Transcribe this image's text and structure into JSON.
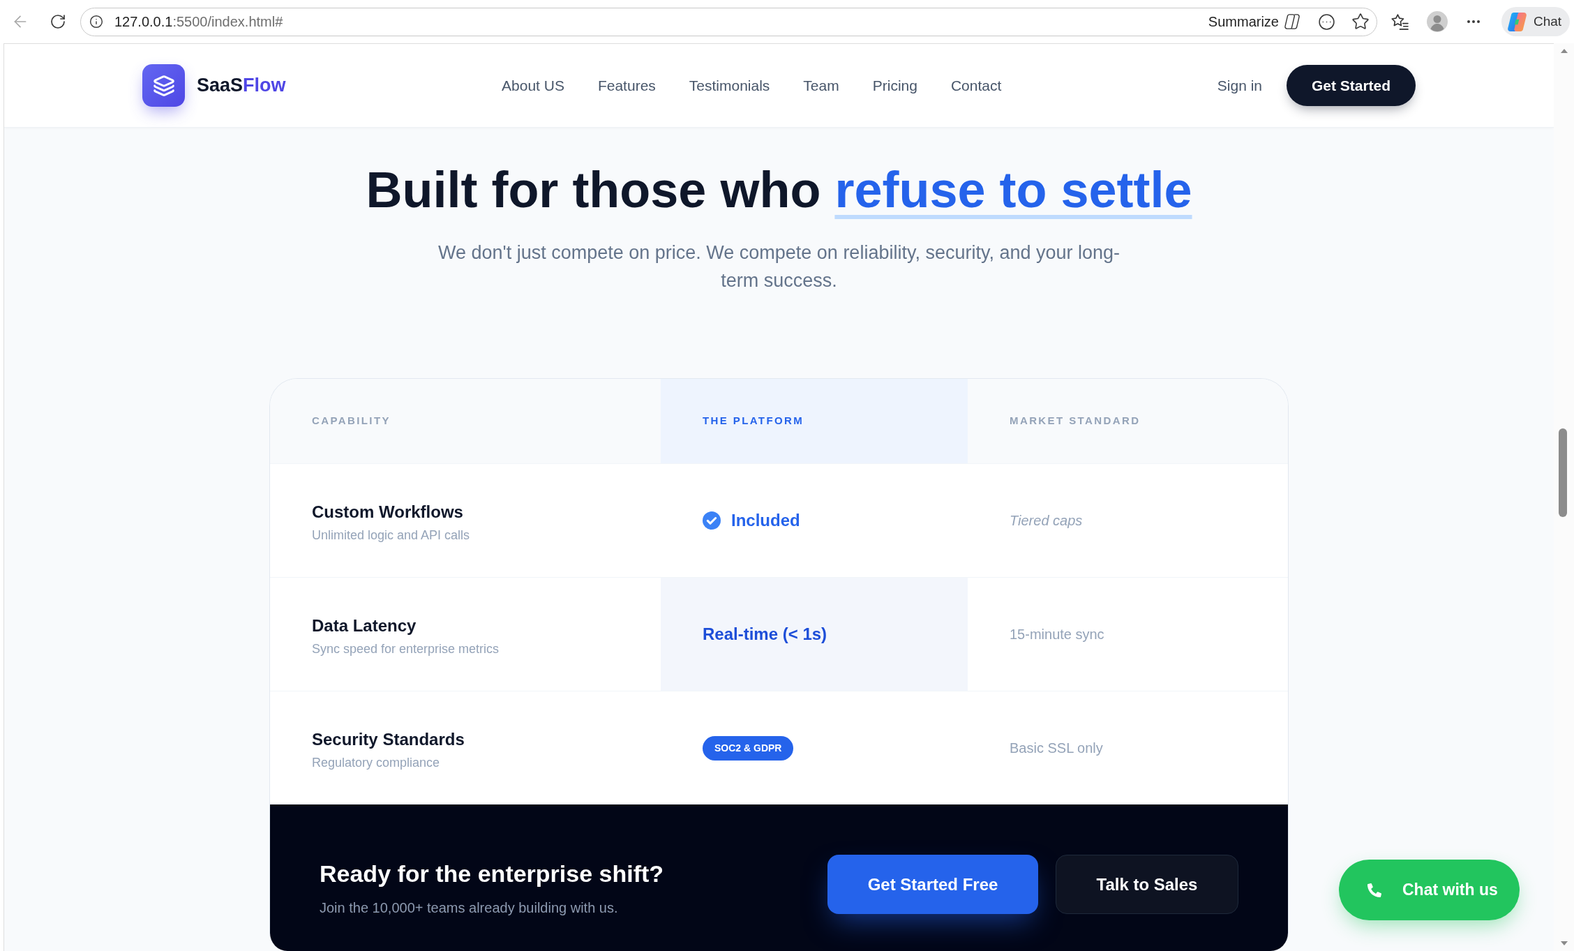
{
  "browser": {
    "url_host": "127.0.0.1",
    "url_path": ":5500/index.html#",
    "summarize_label": "Summarize",
    "chat_label": "Chat"
  },
  "nav": {
    "logo": {
      "text": "SaaS",
      "accent": "Flow"
    },
    "links": [
      "About US",
      "Features",
      "Testimonials",
      "Team",
      "Pricing",
      "Contact"
    ],
    "sign_in": "Sign in",
    "cta": "Get Started"
  },
  "hero": {
    "title": "Built for those who",
    "title_highlight": "refuse to settle",
    "subtitle": "We don't just compete on price. We compete on reliability, security, and your long-term success."
  },
  "comparison": {
    "columns": [
      {
        "label": "CAPABILITY",
        "highlighted": false
      },
      {
        "label": "THE PLATFORM",
        "highlighted": true
      },
      {
        "label": "MARKET STANDARD",
        "highlighted": false
      }
    ],
    "rows": [
      {
        "title": "Custom Workflows",
        "subtitle": "Unlimited logic and API calls",
        "highlighted": false,
        "platform": {
          "kind": "check",
          "text": "Included"
        },
        "market": {
          "text": "Tiered caps",
          "italic": true
        }
      },
      {
        "title": "Data Latency",
        "subtitle": "Sync speed for enterprise metrics",
        "highlighted": true,
        "platform": {
          "kind": "text",
          "text": "Real-time (< 1s)"
        },
        "market": {
          "text": "15-minute sync",
          "italic": false
        }
      },
      {
        "title": "Security Standards",
        "subtitle": "Regulatory compliance",
        "highlighted": false,
        "platform": {
          "kind": "badge",
          "text": "SOC2 & GDPR"
        },
        "market": {
          "text": "Basic SSL only",
          "italic": false
        }
      }
    ]
  },
  "cta": {
    "title": "Ready for the enterprise shift?",
    "subtitle": "Join the 10,000+ teams already building with us.",
    "buttons": [
      {
        "label": "Get Started Free",
        "kind": "primary"
      },
      {
        "label": "Talk to Sales",
        "kind": "secondary"
      }
    ]
  },
  "chat_button": {
    "label": "Chat with us"
  }
}
